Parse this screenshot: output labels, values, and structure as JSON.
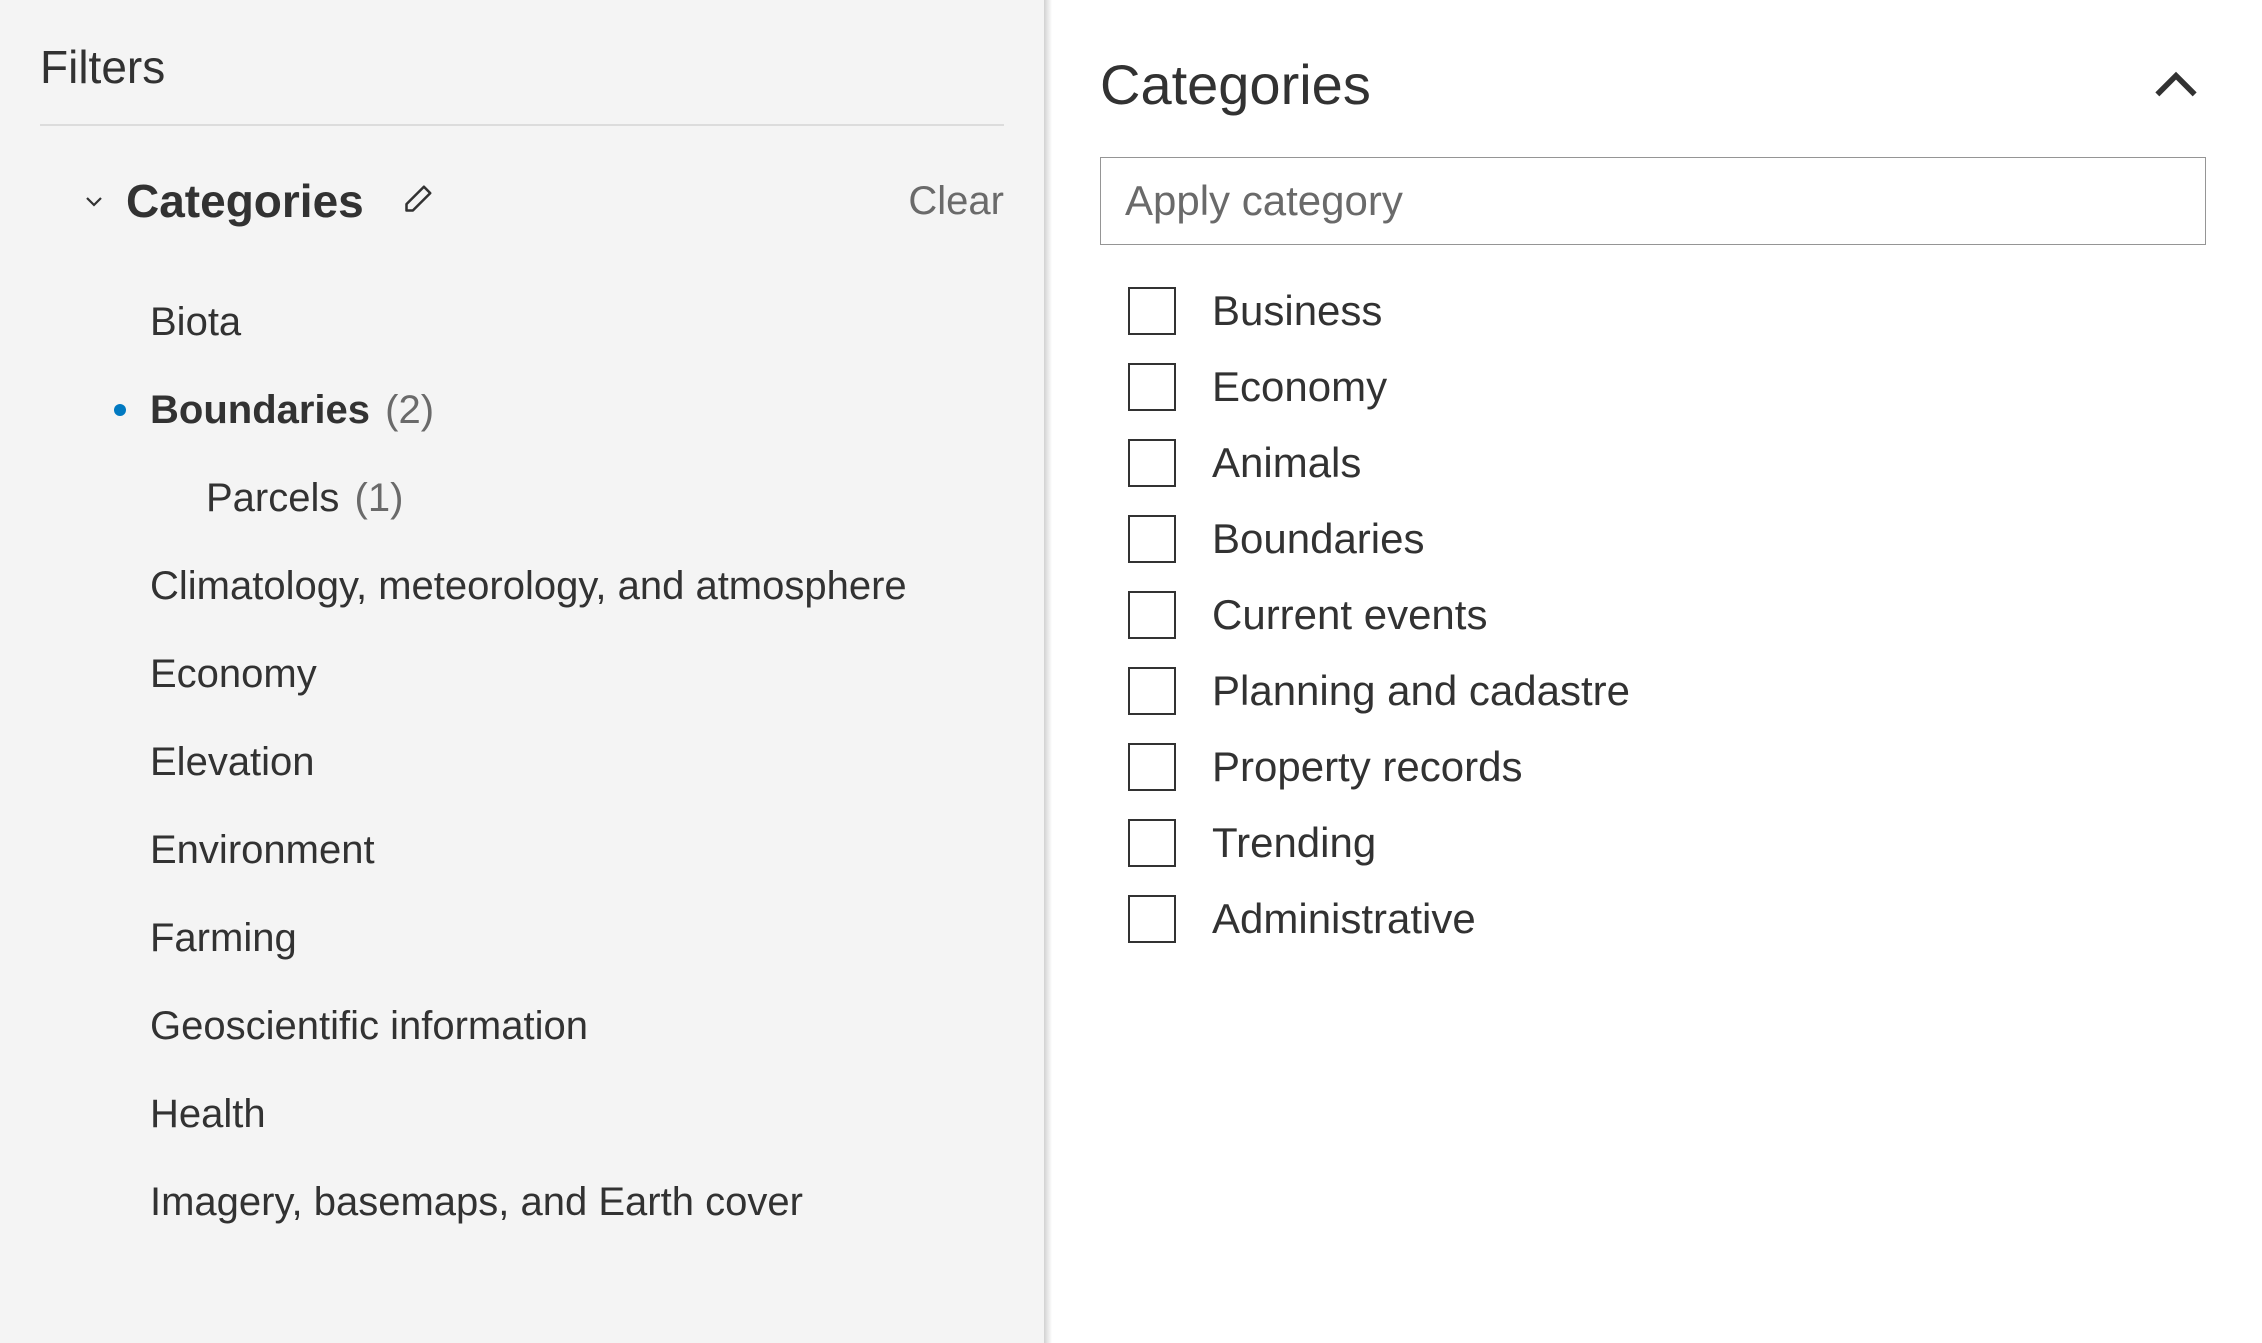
{
  "left": {
    "filters_title": "Filters",
    "section_title": "Categories",
    "clear_label": "Clear",
    "tree": [
      {
        "label": "Biota",
        "selected": false,
        "count": null,
        "children": []
      },
      {
        "label": "Boundaries",
        "selected": true,
        "count": "(2)",
        "children": [
          {
            "label": "Parcels",
            "count": "(1)"
          }
        ]
      },
      {
        "label": "Climatology, meteorology, and atmosphere",
        "selected": false,
        "count": null,
        "children": []
      },
      {
        "label": "Economy",
        "selected": false,
        "count": null,
        "children": []
      },
      {
        "label": "Elevation",
        "selected": false,
        "count": null,
        "children": []
      },
      {
        "label": "Environment",
        "selected": false,
        "count": null,
        "children": []
      },
      {
        "label": "Farming",
        "selected": false,
        "count": null,
        "children": []
      },
      {
        "label": "Geoscientific information",
        "selected": false,
        "count": null,
        "children": []
      },
      {
        "label": "Health",
        "selected": false,
        "count": null,
        "children": []
      },
      {
        "label": "Imagery, basemaps, and Earth cover",
        "selected": false,
        "count": null,
        "children": []
      }
    ]
  },
  "right": {
    "title": "Categories",
    "input_placeholder": "Apply category",
    "options": [
      {
        "label": "Business"
      },
      {
        "label": "Economy"
      },
      {
        "label": "Animals"
      },
      {
        "label": "Boundaries"
      },
      {
        "label": "Current events"
      },
      {
        "label": "Planning and cadastre"
      },
      {
        "label": "Property records"
      },
      {
        "label": "Trending"
      },
      {
        "label": "Administrative"
      }
    ]
  }
}
